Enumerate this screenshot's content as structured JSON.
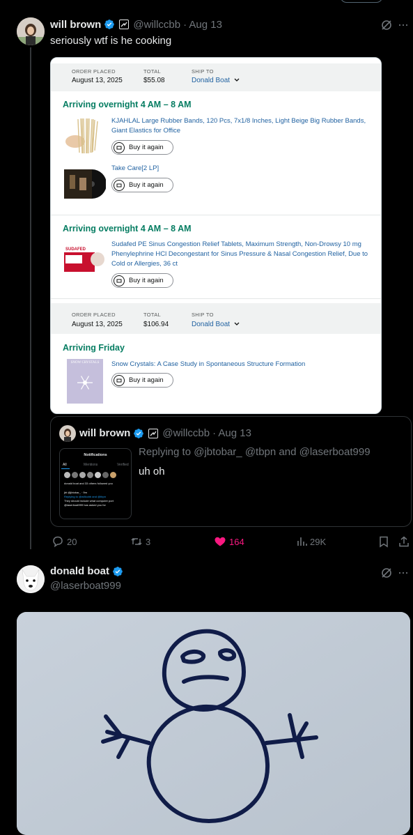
{
  "tweet1": {
    "author_name": "will brown",
    "handle": "@willccbb",
    "date": "· Aug 13",
    "text": "seriously wtf is he cooking"
  },
  "order1": {
    "order_placed_label": "ORDER PLACED",
    "order_placed_value": "August 13, 2025",
    "total_label": "TOTAL",
    "total_value": "$55.08",
    "ship_to_label": "SHIP TO",
    "ship_to_value": "Donald Boat",
    "shipments": [
      {
        "arriving": "Arriving overnight 4 AM – 8 AM",
        "items": [
          {
            "title": "KJAHLAL Large Rubber Bands, 120 Pcs, 7x1/8 Inches, Light Beige Big Rubber Bands, Giant Elastics for Office",
            "button": "Buy it again"
          },
          {
            "title": "Take Care[2 LP]",
            "button": "Buy it again"
          }
        ]
      },
      {
        "arriving": "Arriving overnight 4 AM – 8 AM",
        "items": [
          {
            "title": "Sudafed PE Sinus Congestion Relief Tablets, Maximum Strength, Non-Drowsy 10 mg Phenylephrine HCl Decongestant for Sinus Pressure & Nasal Congestion Relief, Due to Cold or Allergies, 36 ct",
            "button": "Buy it again",
            "image_label": "SUDAFED"
          }
        ]
      }
    ]
  },
  "order2": {
    "order_placed_label": "ORDER PLACED",
    "order_placed_value": "August 13, 2025",
    "total_label": "TOTAL",
    "total_value": "$106.94",
    "ship_to_label": "SHIP TO",
    "ship_to_value": "Donald Boat",
    "arriving": "Arriving Friday",
    "item_title": "Snow Crystals: A Case Study in Spontaneous Structure Formation",
    "item_button": "Buy it again",
    "book_cover_title": "SNOW CRYSTALS"
  },
  "quote": {
    "author_name": "will brown",
    "handle": "@willccbb",
    "date": "· Aug 13",
    "replying": "Replying to @jbtobar_ @tbpn and @laserboat999",
    "text": "uh oh",
    "thumb": {
      "title": "Notifications",
      "tabs": [
        "All",
        "Mentions",
        "Verified"
      ],
      "line1": "donald boat and 33 others followed you",
      "line2": "jbt @jbtobar_ · 9m",
      "line3": "Replying to @willccbb and @tbpn",
      "line4": "They should include what computer port @laserboat999 has asked you for"
    }
  },
  "actions": {
    "replies": "20",
    "retweets": "3",
    "likes": "164",
    "views": "29K"
  },
  "tweet2": {
    "author_name": "donald boat",
    "handle": "@laserboat999"
  },
  "colors": {
    "like": "#f91880",
    "verified": "#1d9bf0",
    "amazon_link": "#2162a1",
    "amazon_green": "#067d62"
  }
}
